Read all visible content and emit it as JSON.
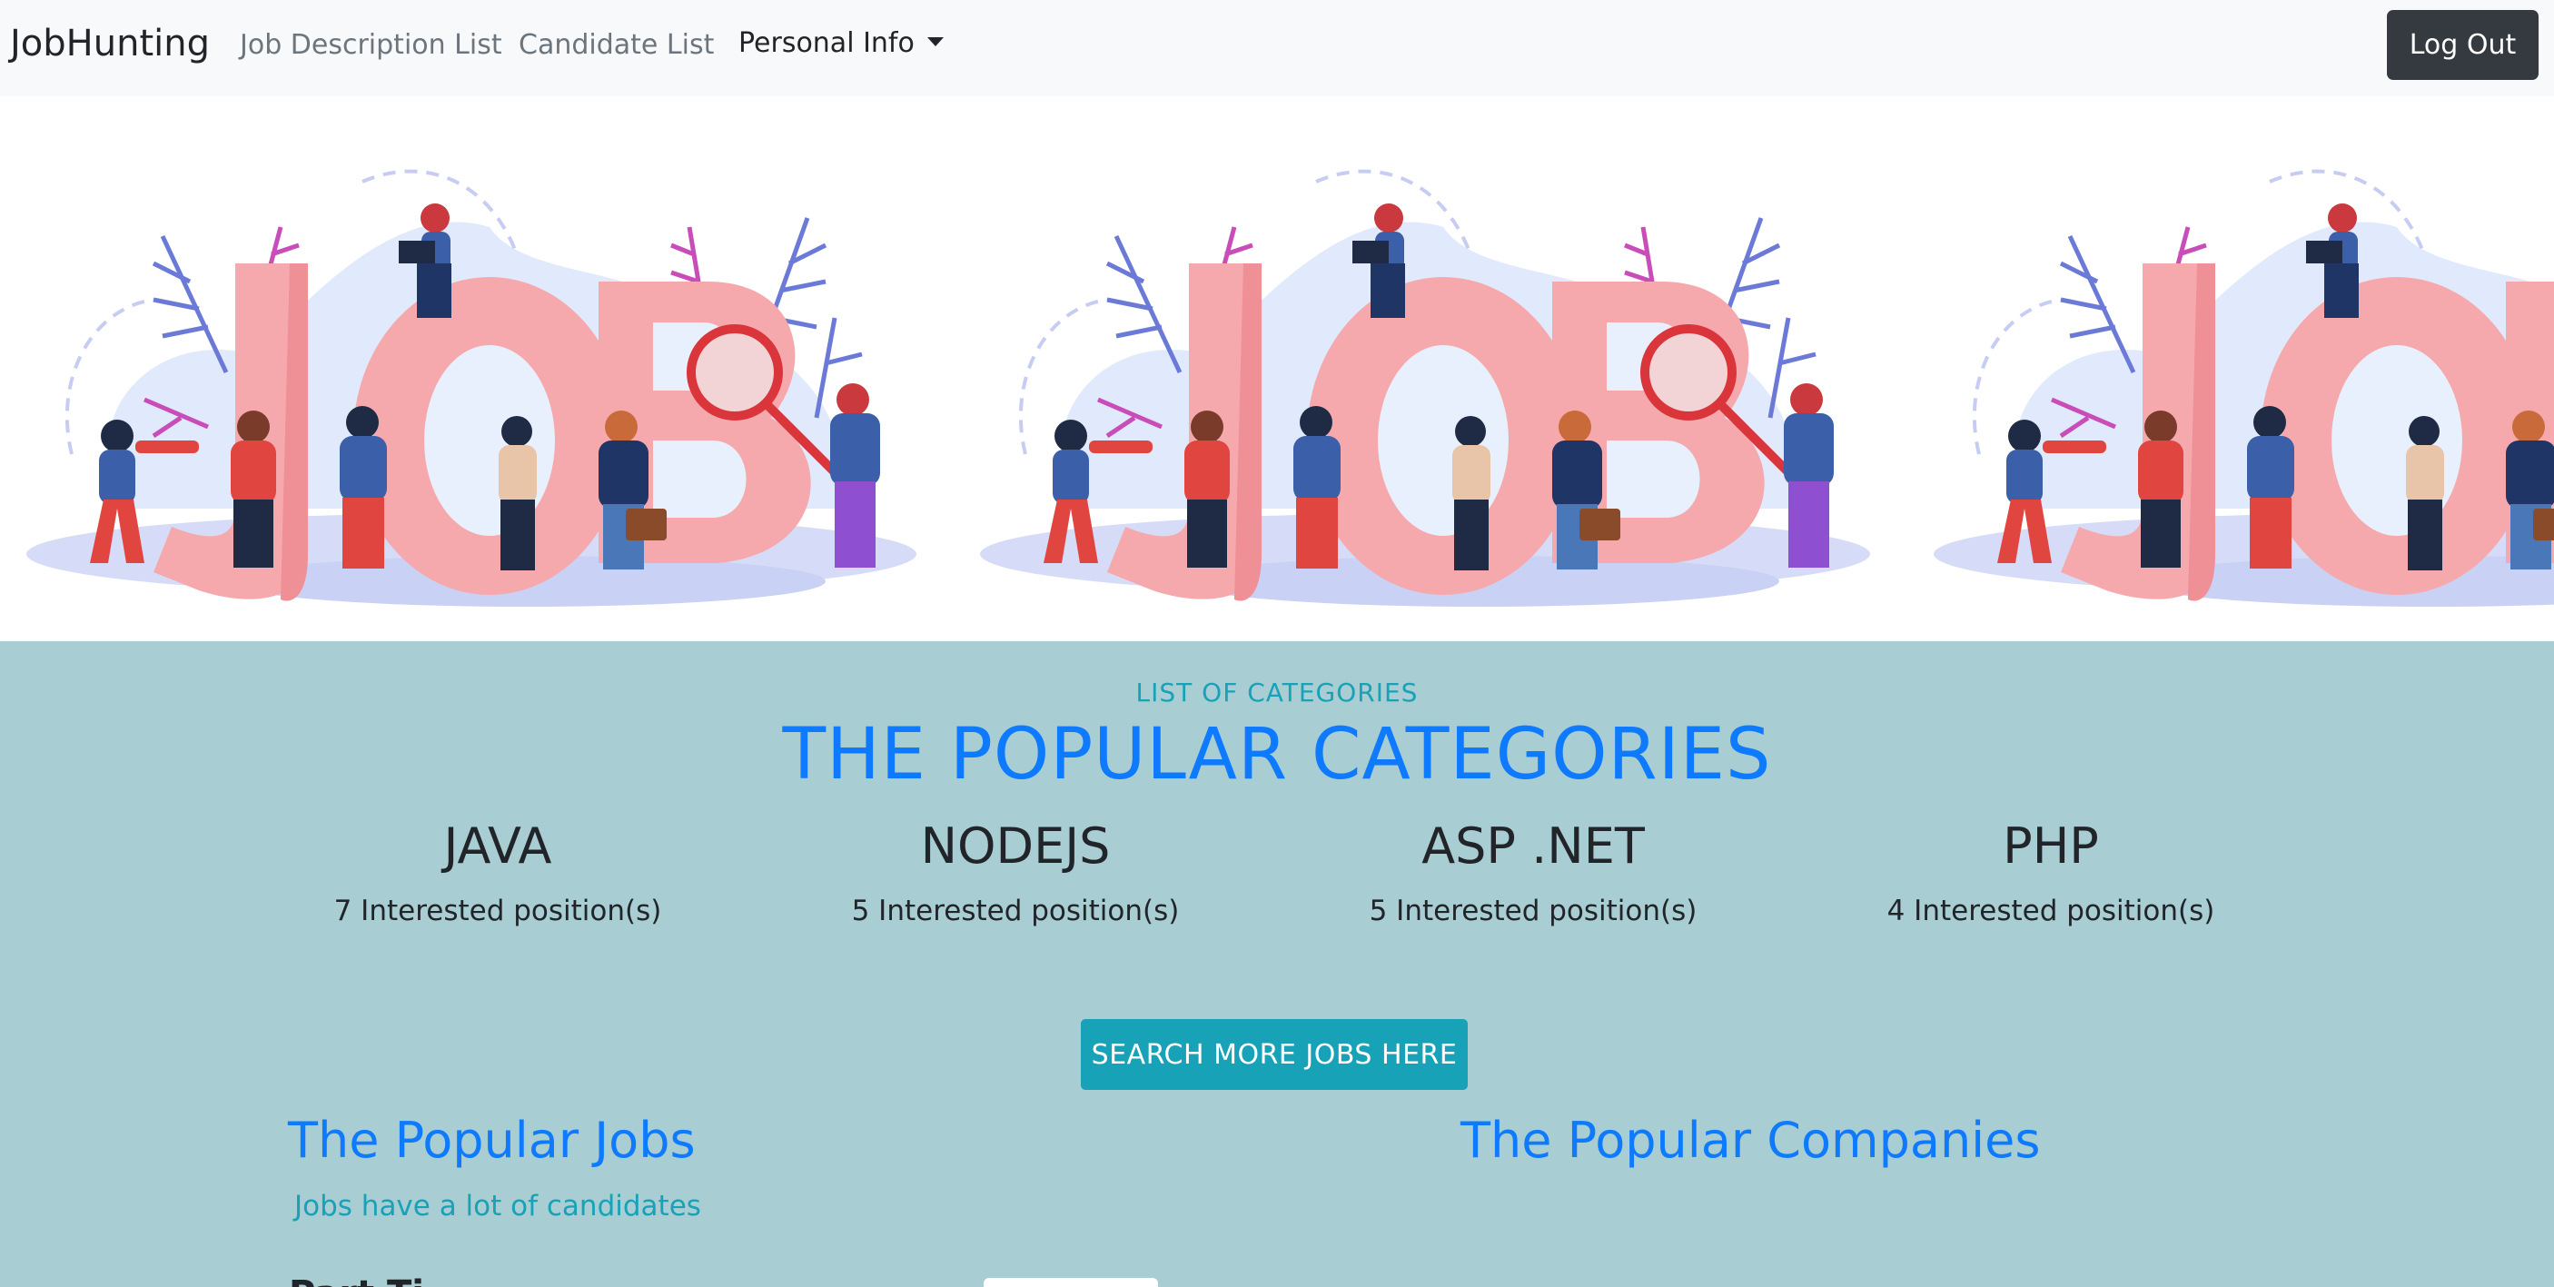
{
  "navbar": {
    "brand": "JobHunting",
    "links": [
      "Job Description List",
      "Candidate List"
    ],
    "personal_info": "Personal Info",
    "logout": "Log Out"
  },
  "categories": {
    "kicker": "LIST OF CATEGORIES",
    "title": "THE POPULAR CATEGORIES",
    "items": [
      {
        "name": "JAVA",
        "count": "7 Interested position(s)"
      },
      {
        "name": "NODEJS",
        "count": "5 Interested position(s)"
      },
      {
        "name": "ASP .NET",
        "count": "5 Interested position(s)"
      },
      {
        "name": "PHP",
        "count": "4 Interested position(s)"
      }
    ],
    "search_button": "SEARCH MORE JOBS HERE"
  },
  "popular_jobs": {
    "title": "The Popular Jobs",
    "subtitle": "Jobs have a lot of candidates",
    "first_item_partial": "Part Ti"
  },
  "popular_companies": {
    "title": "The Popular Companies"
  },
  "colors": {
    "navbar_bg": "#f8f9fa",
    "section_bg": "#a8cdd2",
    "primary": "#0d7aff",
    "info": "#17a2b8",
    "dark": "#343a40"
  }
}
